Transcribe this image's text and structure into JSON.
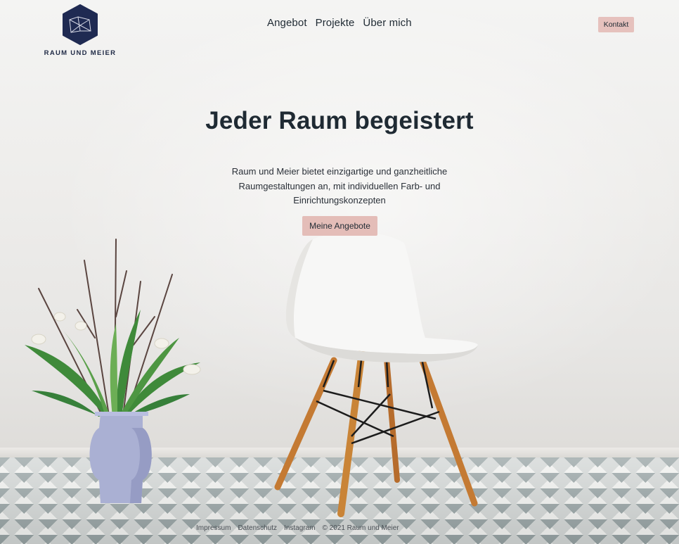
{
  "header": {
    "logo_text": "RAUM UND MEIER",
    "nav": [
      "Angebot",
      "Projekte",
      "Über mich"
    ],
    "contact_label": "Kontakt"
  },
  "hero": {
    "title": "Jeder Raum begeistert",
    "text": "Raum und Meier bietet einzigartige und ganzheitliche Raumgestaltungen an, mit individuellen Farb- und Einrichtungskonzepten",
    "cta_label": "Meine Angebote"
  },
  "footer": {
    "links": [
      "Impressum",
      "Datenschutz",
      "Instagram"
    ],
    "copyright": "© 2021 Raum und Meier"
  },
  "colors": {
    "brand_navy": "#1f2a45",
    "button_pink": "#e6c1bd",
    "text_dark": "#1f2a33"
  },
  "icons": {
    "logo": "rm-hexagon-logo"
  }
}
